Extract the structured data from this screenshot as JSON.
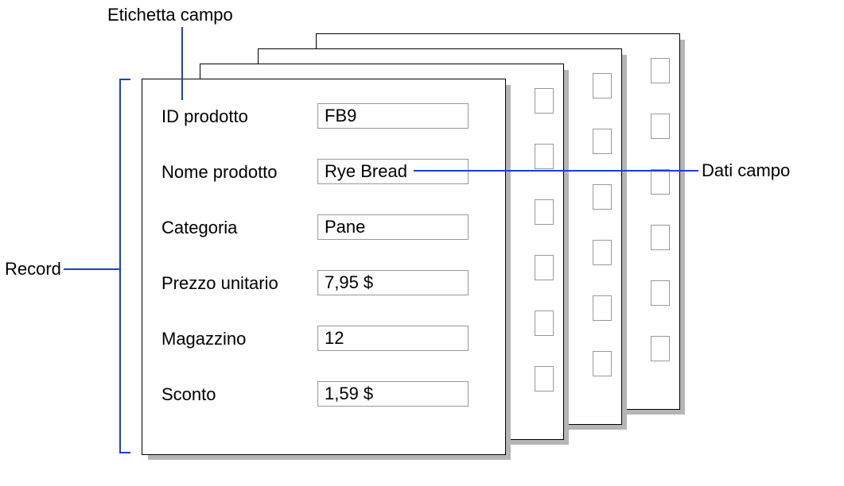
{
  "annotations": {
    "etichetta_campo": "Etichetta campo",
    "dati_campo": "Dati campo",
    "record": "Record"
  },
  "fields": [
    {
      "label": "ID prodotto",
      "value": "FB9"
    },
    {
      "label": "Nome prodotto",
      "value": "Rye Bread"
    },
    {
      "label": "Categoria",
      "value": "Pane"
    },
    {
      "label": "Prezzo unitario",
      "value": "7,95 $"
    },
    {
      "label": "Magazzino",
      "value": "12"
    },
    {
      "label": "Sconto",
      "value": "1,59 $"
    }
  ],
  "colors": {
    "line": "#1a3fd6"
  }
}
